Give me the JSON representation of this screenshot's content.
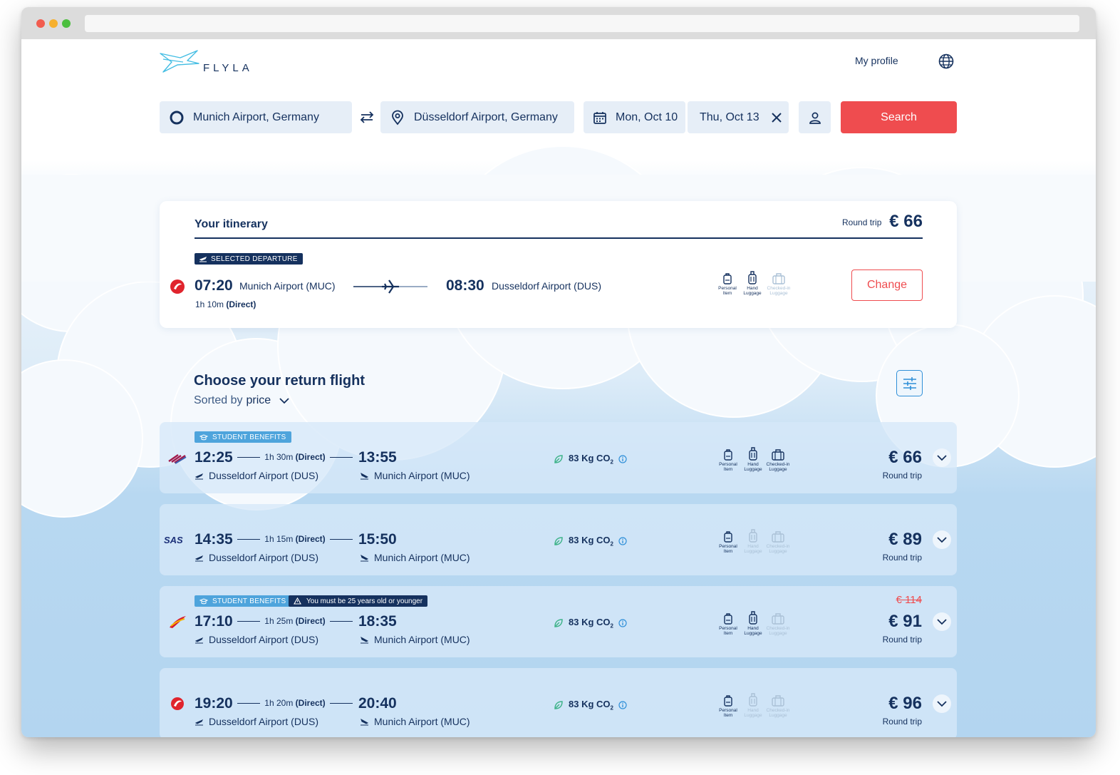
{
  "header": {
    "logo_text": "FLYLA",
    "profile_link": "My profile"
  },
  "search": {
    "origin": "Munich Airport, Germany",
    "destination": "Düsseldorf Airport, Germany",
    "depart_date": "Mon, Oct 10",
    "return_date": "Thu, Oct 13",
    "search_label": "Search"
  },
  "itinerary": {
    "title": "Your itinerary",
    "trip_type": "Round trip",
    "total_price": "€ 66",
    "tag": "SELECTED DEPARTURE",
    "dep_time": "07:20",
    "dep_airport": "Munich Airport (MUC)",
    "arr_time": "08:30",
    "arr_airport": "Dusseldorf Airport (DUS)",
    "duration": "1h 10m",
    "stops": "(Direct)",
    "luggage": [
      {
        "line1": "Personal",
        "line2": "Item",
        "included": true
      },
      {
        "line1": "Hand",
        "line2": "Luggage",
        "included": true
      },
      {
        "line1": "Checked-in",
        "line2": "Luggage",
        "included": false
      }
    ],
    "change_label": "Change"
  },
  "results": {
    "title": "Choose your return flight",
    "sorted_prefix": "Sorted by",
    "sorted_value": "price",
    "flights": [
      {
        "airline_icon": "eurowings-logo",
        "tags": [
          "STUDENT BENEFITS"
        ],
        "warning": "",
        "dep_time": "12:25",
        "duration": "1h 30m",
        "stops": "(Direct)",
        "arr_time": "13:55",
        "dep_airport": "Dusseldorf Airport (DUS)",
        "arr_airport": "Munich Airport (MUC)",
        "co2": "83 Kg CO",
        "co2_sub": "2",
        "luggage": [
          {
            "line1": "Personal",
            "line2": "Item",
            "included": true
          },
          {
            "line1": "Hand",
            "line2": "Luggage",
            "included": true
          },
          {
            "line1": "Checked-in",
            "line2": "Luggage",
            "included": true
          }
        ],
        "old_price": "",
        "price": "€ 66",
        "price_note": "Round trip"
      },
      {
        "airline_icon": "sas-logo",
        "tags": [],
        "warning": "",
        "dep_time": "14:35",
        "duration": "1h 15m",
        "stops": "(Direct)",
        "arr_time": "15:50",
        "dep_airport": "Dusseldorf Airport (DUS)",
        "arr_airport": "Munich Airport (MUC)",
        "co2": "83 Kg CO",
        "co2_sub": "2",
        "luggage": [
          {
            "line1": "Personal",
            "line2": "Item",
            "included": true
          },
          {
            "line1": "Hand",
            "line2": "Luggage",
            "included": false
          },
          {
            "line1": "Checked-in",
            "line2": "Luggage",
            "included": false
          }
        ],
        "old_price": "",
        "price": "€ 89",
        "price_note": "Round trip"
      },
      {
        "airline_icon": "iberia-logo",
        "tags": [
          "STUDENT BENEFITS"
        ],
        "warning": "You must be 25 years old or younger",
        "dep_time": "17:10",
        "duration": "1h 25m",
        "stops": "(Direct)",
        "arr_time": "18:35",
        "dep_airport": "Dusseldorf Airport (DUS)",
        "arr_airport": "Munich Airport (MUC)",
        "co2": "83 Kg CO",
        "co2_sub": "2",
        "luggage": [
          {
            "line1": "Personal",
            "line2": "Item",
            "included": true
          },
          {
            "line1": "Hand",
            "line2": "Luggage",
            "included": true
          },
          {
            "line1": "Checked-in",
            "line2": "Luggage",
            "included": false
          }
        ],
        "old_price": "€ 114",
        "price": "€ 91",
        "price_note": "Round trip"
      },
      {
        "airline_icon": "turkish-airlines-logo",
        "tags": [],
        "warning": "",
        "dep_time": "19:20",
        "duration": "1h 20m",
        "stops": "(Direct)",
        "arr_time": "20:40",
        "dep_airport": "Dusseldorf Airport (DUS)",
        "arr_airport": "Munich Airport (MUC)",
        "co2": "83 Kg CO",
        "co2_sub": "2",
        "luggage": [
          {
            "line1": "Personal",
            "line2": "Item",
            "included": true
          },
          {
            "line1": "Hand",
            "line2": "Luggage",
            "included": false
          },
          {
            "line1": "Checked-in",
            "line2": "Luggage",
            "included": false
          }
        ],
        "old_price": "",
        "price": "€ 96",
        "price_note": "Round trip"
      }
    ]
  },
  "colors": {
    "brand_navy": "#15315e",
    "accent_red": "#ef4c4f",
    "student_blue": "#4ea4dc",
    "co2_green": "#3fb38a",
    "info_blue": "#2f8fd8"
  }
}
